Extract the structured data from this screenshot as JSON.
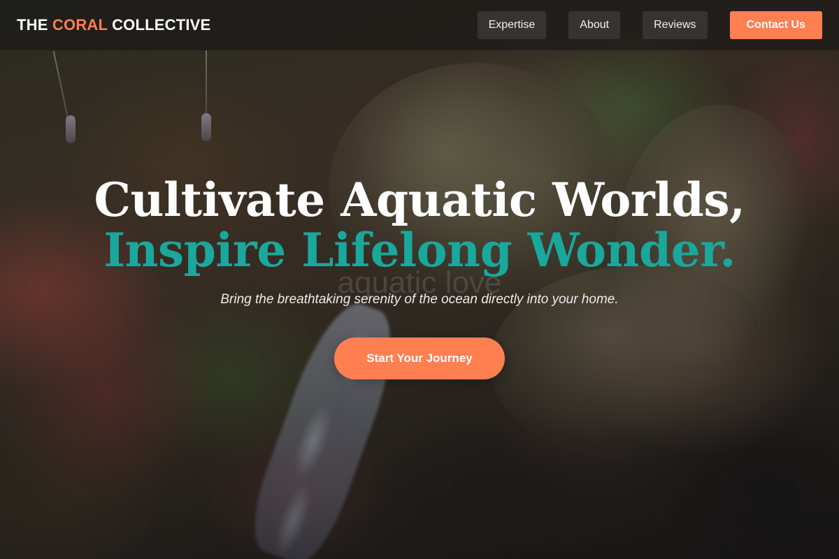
{
  "header": {
    "logo": {
      "prefix": "THE",
      "accent": "CORAL",
      "suffix": "COLLECTIVE"
    },
    "nav": [
      {
        "label": "Expertise"
      },
      {
        "label": "About"
      },
      {
        "label": "Reviews"
      }
    ],
    "cta_label": "Contact Us"
  },
  "hero": {
    "headline_line1": "Cultivate Aquatic Worlds,",
    "headline_line2": "Inspire Lifelong Wonder.",
    "background_caption": "aquatic love",
    "subtitle": "Bring the breathtaking serenity of the ocean directly into your home.",
    "cta_label": "Start Your Journey"
  },
  "colors": {
    "accent_coral": "#ff7f50",
    "accent_teal": "#1aa89c",
    "header_bg": "#141416",
    "nav_button_bg": "#3c3c3c"
  }
}
